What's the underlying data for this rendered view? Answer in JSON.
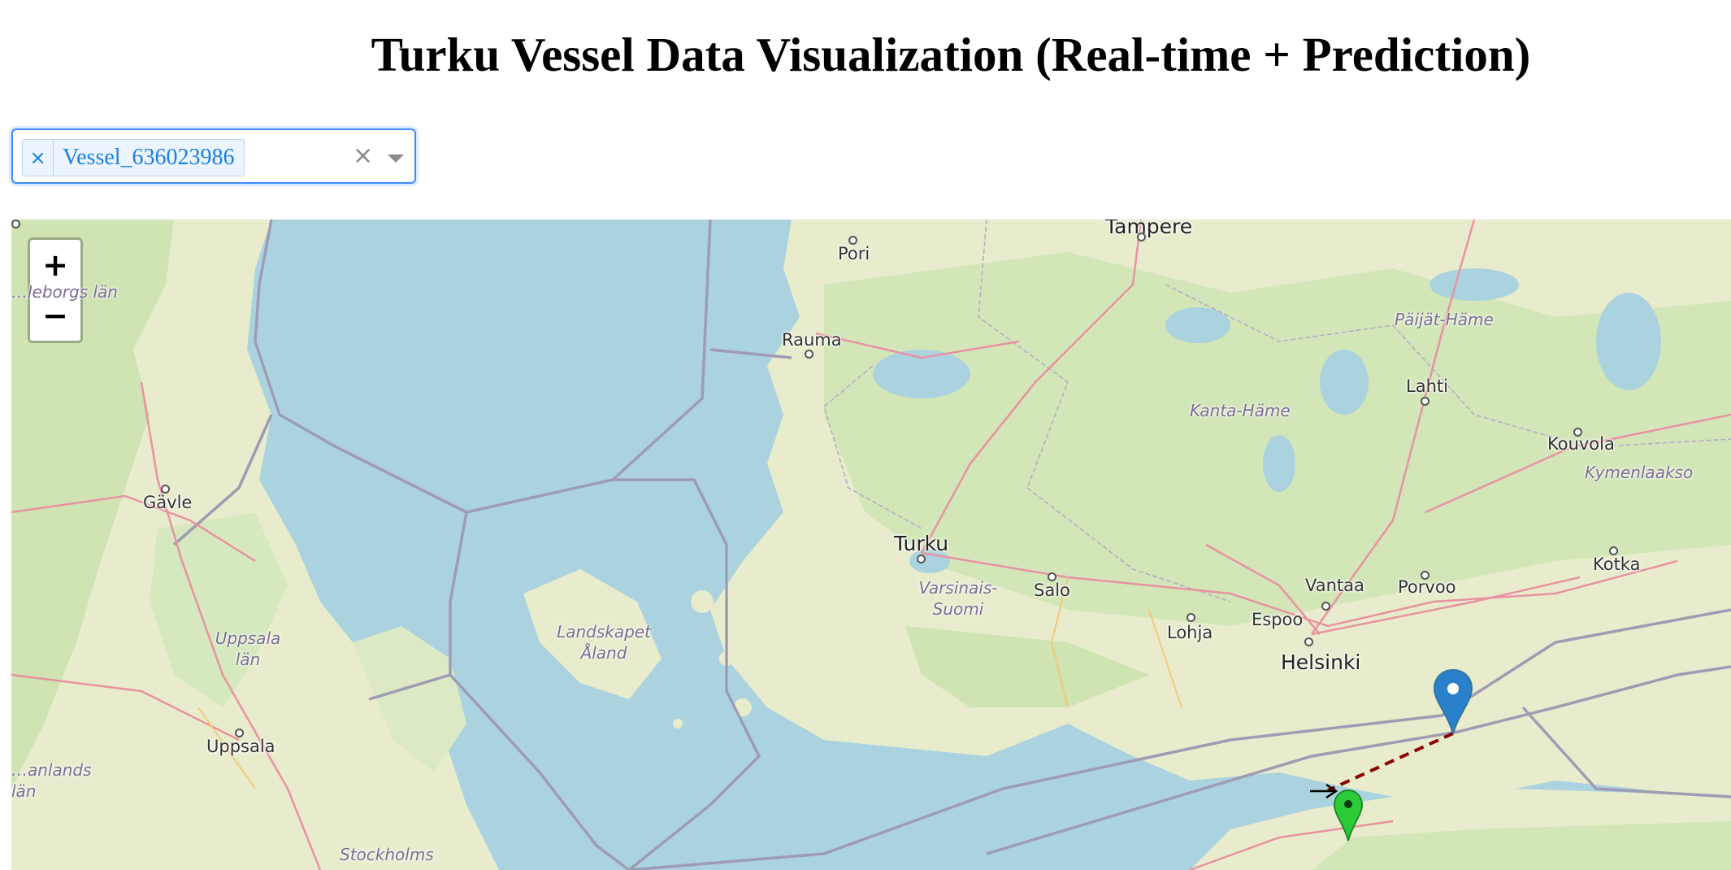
{
  "page": {
    "title": "Turku Vessel Data Visualization (Real-time + Prediction)"
  },
  "vessel_selector": {
    "selected": [
      "Vessel_636023986"
    ],
    "remove_glyph": "×",
    "clear_glyph": "×"
  },
  "map": {
    "zoom_in_label": "+",
    "zoom_out_label": "−",
    "cities": [
      "Tampere",
      "Pori",
      "Rauma",
      "Lahti",
      "Kouvola",
      "Kotka",
      "Turku",
      "Salo",
      "Vantaa",
      "Porvoo",
      "Espoo",
      "Helsinki",
      "Lohja",
      "Gävle",
      "Uppsala"
    ],
    "regions": [
      "Päijät-Häme",
      "Kanta-Häme",
      "Kymenlaakso",
      "Varsinais-Suomi",
      "Landskapet Åland",
      "Uppsala län",
      "Stockholms",
      "…leborgs län",
      "…anlands län"
    ],
    "markers": [
      {
        "name": "current-position",
        "color": "#2a81cb"
      },
      {
        "name": "predicted-position",
        "color": "#2ccc38"
      }
    ],
    "track_color": "#8b0000"
  }
}
